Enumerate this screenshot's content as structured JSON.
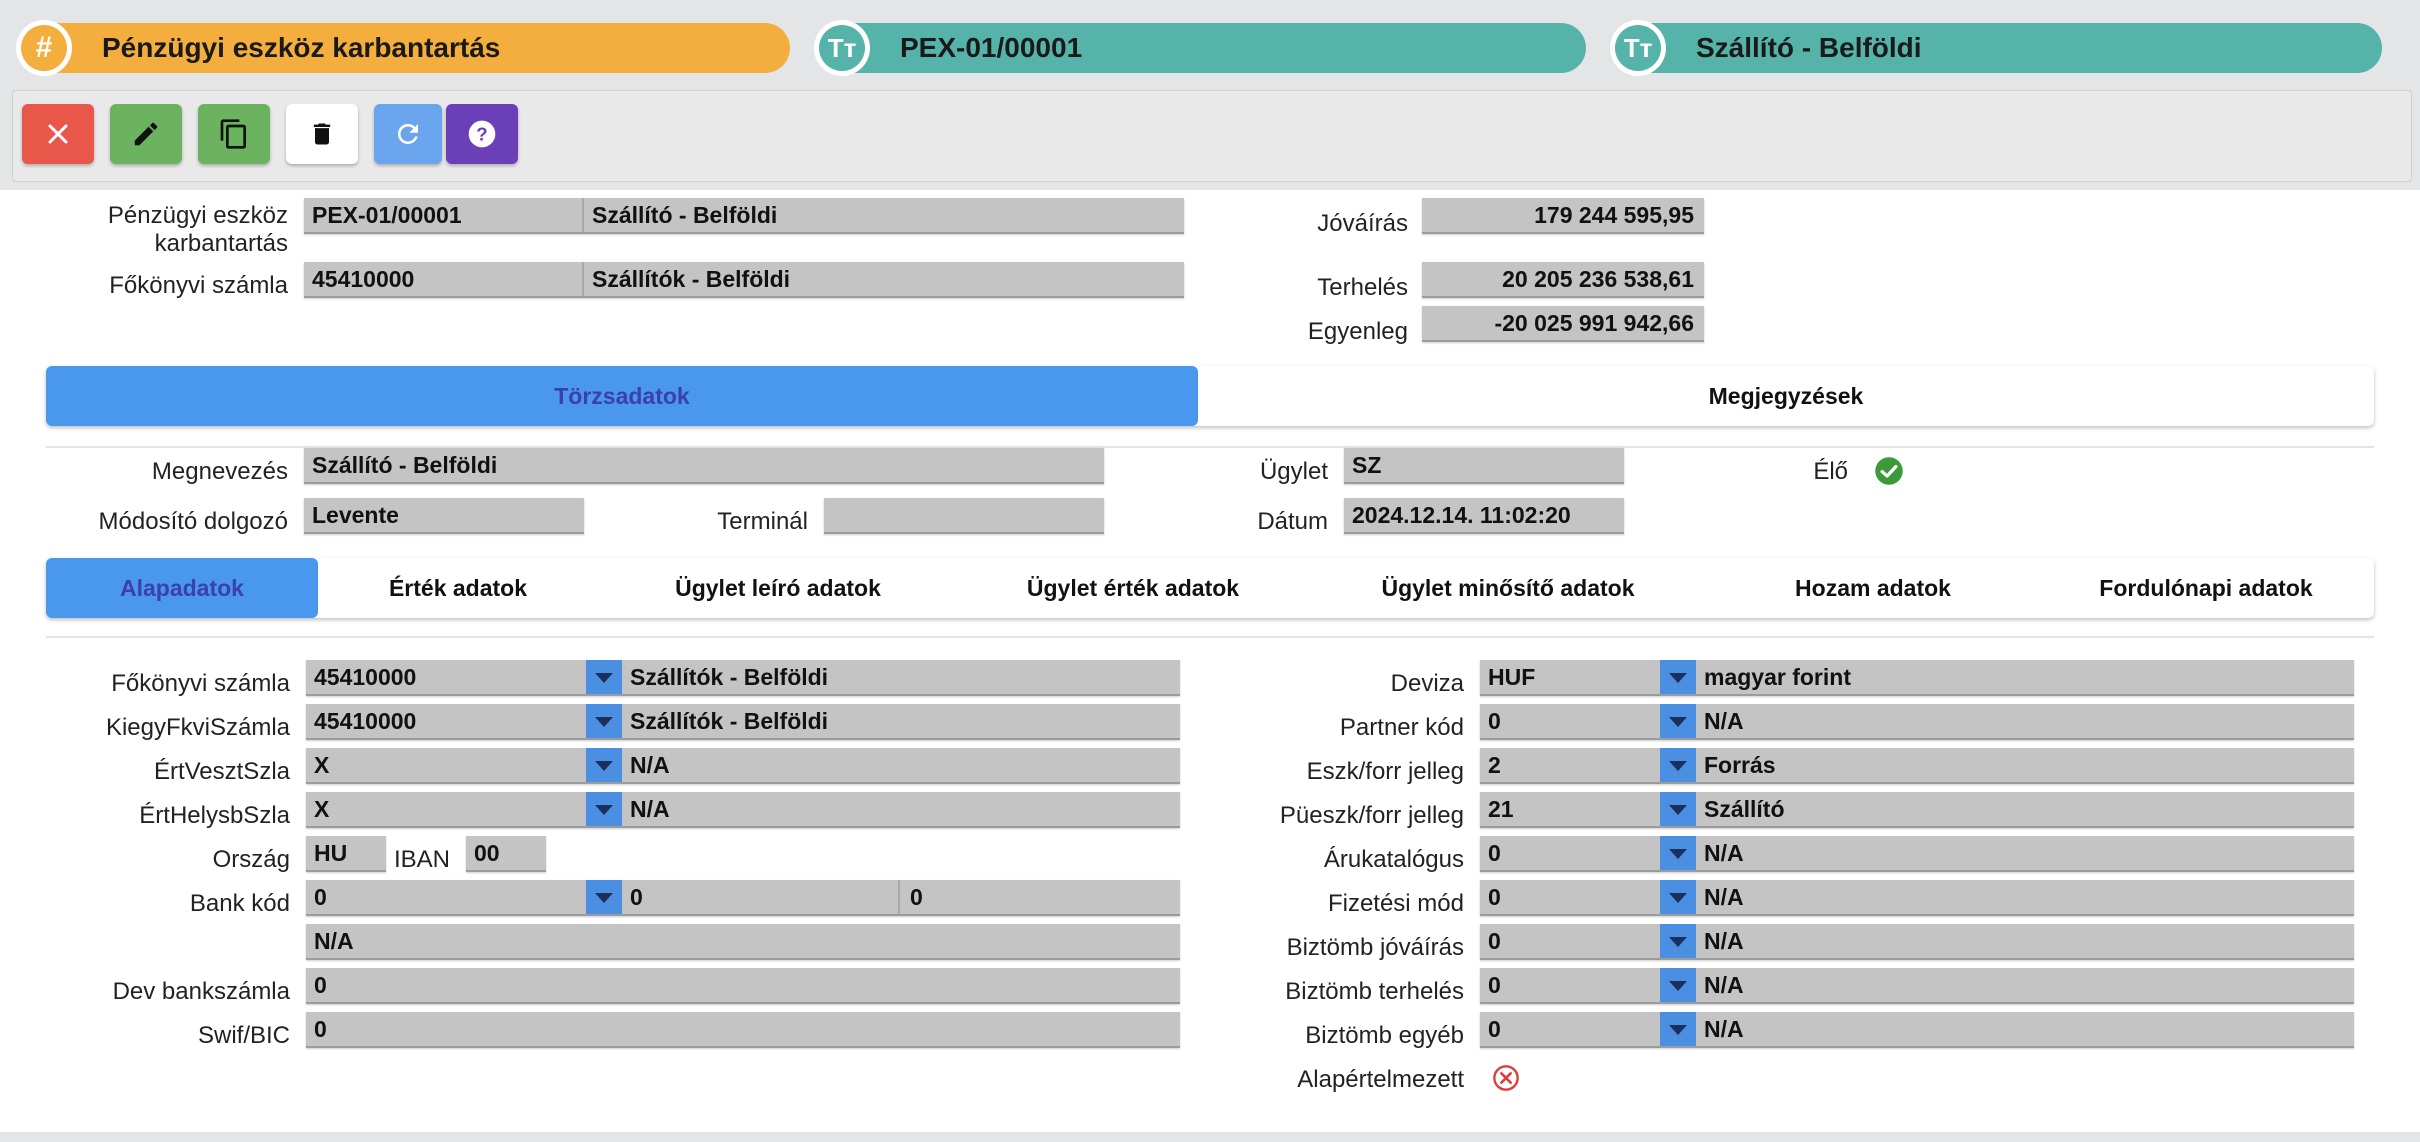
{
  "header": {
    "title": "Pénzügyi eszköz karbantartás",
    "code": "PEX-01/00001",
    "name": "Szállító - Belföldi",
    "badge_hash": "#",
    "badge_t2": "Tт",
    "badge_t3": "Tт"
  },
  "toolbar": {
    "buttons": [
      "close-icon",
      "edit-icon",
      "copy-icon",
      "delete-icon",
      "refresh-icon",
      "help-icon"
    ],
    "colors": {
      "close": "#e8574a",
      "edit": "#6cb35f",
      "copy": "#6cb35f",
      "delete": "#ffffff",
      "refresh": "#6aa5ee",
      "help": "#6b3fb8"
    }
  },
  "top": {
    "pex_label": "Pénzügyi eszköz karbantartás",
    "pex_code": "PEX-01/00001",
    "pex_name": "Szállító - Belföldi",
    "fokonyv_label": "Főkönyvi számla",
    "fokonyv_code": "45410000",
    "fokonyv_name": "Szállítók - Belföldi",
    "jovairas_label": "Jóváírás",
    "jovairas_value": "179 244 595,95",
    "terheles_label": "Terhelés",
    "terheles_value": "20 205 236 538,61",
    "egyenleg_label": "Egyenleg",
    "egyenleg_value": "-20 025 991 942,66"
  },
  "main_tabs": [
    {
      "label": "Törzsadatok",
      "active": true
    },
    {
      "label": "Megjegyzések",
      "active": false
    }
  ],
  "torzs": {
    "megnevezes_label": "Megnevezés",
    "megnevezes_value": "Szállító - Belföldi",
    "modosito_label": "Módosító dolgozó",
    "modosito_value": "Levente",
    "terminal_label": "Terminál",
    "terminal_value": "",
    "ugylet_label": "Ügylet",
    "ugylet_value": "SZ",
    "datum_label": "Dátum",
    "datum_value": "2024.12.14. 11:02:20",
    "elo_label": "Élő",
    "elo_checked": true
  },
  "sub_tabs": [
    {
      "label": "Alapadatok",
      "active": true
    },
    {
      "label": "Érték adatok",
      "active": false
    },
    {
      "label": "Ügylet leíró adatok",
      "active": false
    },
    {
      "label": "Ügylet érték adatok",
      "active": false
    },
    {
      "label": "Ügylet minősítő adatok",
      "active": false
    },
    {
      "label": "Hozam adatok",
      "active": false
    },
    {
      "label": "Fordulónapi adatok",
      "active": false
    }
  ],
  "left_fields": [
    {
      "label": "Főkönyvi számla",
      "code": "45410000",
      "name": "Szállítók - Belföldi"
    },
    {
      "label": "KiegyFkviSzámla",
      "code": "45410000",
      "name": "Szállítók - Belföldi"
    },
    {
      "label": "ÉrtVesztSzla",
      "code": "X",
      "name": "N/A"
    },
    {
      "label": "ÉrtHelysbSzla",
      "code": "X",
      "name": "N/A"
    }
  ],
  "orszag": {
    "label": "Ország",
    "value": "HU",
    "iban_label": "IBAN",
    "iban_value": "00"
  },
  "bank": {
    "label": "Bank kód",
    "code": "0",
    "v2": "0",
    "v3": "0",
    "name": "N/A"
  },
  "dev_bank": {
    "label": "Dev bankszámla",
    "value": "0"
  },
  "swift": {
    "label": "Swif/BIC",
    "value": "0"
  },
  "right_fields": [
    {
      "label": "Deviza",
      "code": "HUF",
      "name": "magyar forint"
    },
    {
      "label": "Partner kód",
      "code": "0",
      "name": "N/A"
    },
    {
      "label": "Eszk/forr jelleg",
      "code": "2",
      "name": "Forrás"
    },
    {
      "label": "Püeszk/forr jelleg",
      "code": "21",
      "name": "Szállító"
    },
    {
      "label": "Árukatalógus",
      "code": "0",
      "name": "N/A"
    },
    {
      "label": "Fizetési mód",
      "code": "0",
      "name": "N/A"
    },
    {
      "label": "Biztömb jóváírás",
      "code": "0",
      "name": "N/A"
    },
    {
      "label": "Biztömb terhelés",
      "code": "0",
      "name": "N/A"
    },
    {
      "label": "Biztömb egyéb",
      "code": "0",
      "name": "N/A"
    }
  ],
  "alapertelmezett": {
    "label": "Alapértelmezett",
    "checked": false
  }
}
